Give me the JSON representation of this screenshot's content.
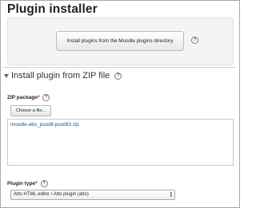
{
  "page": {
    "title": "Plugin installer"
  },
  "directory": {
    "button_label": "Install plugins from the Moodle plugins directory",
    "help_icon": "question-circle"
  },
  "zip_section": {
    "legend": "Install plugin from ZIP file",
    "collapse_icon": "triangle-down",
    "zip_package": {
      "label": "ZIP package",
      "required_marker": "*",
      "choose_button": "Choose a file...",
      "file_name": "moodle-atto_poodll-poodll3.zip"
    },
    "plugin_type": {
      "label": "Plugin type",
      "required_marker": "*",
      "selected": "Atto HTML editor / Atto plugin (atto)",
      "arrows": [
        "▴",
        "▾"
      ]
    }
  },
  "colors": {
    "link": "#0b5ca8",
    "required": "#c00000",
    "panel_background": "#f4f4f4"
  }
}
